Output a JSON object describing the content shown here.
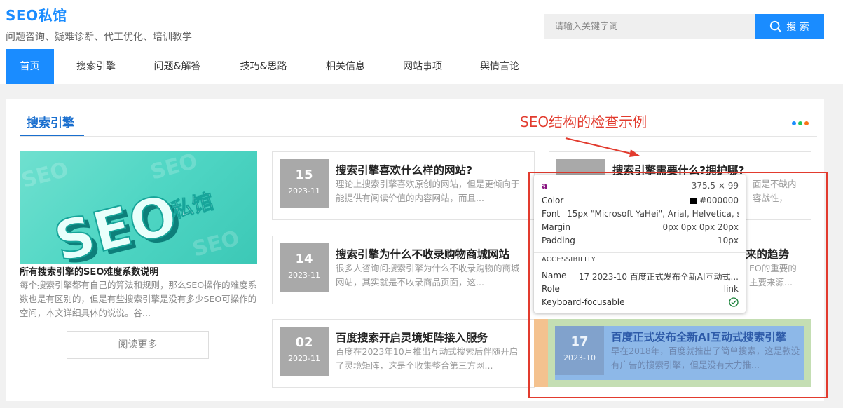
{
  "header": {
    "logo": "SEO私馆",
    "tagline": "问题咨询、疑难诊断、代工优化、培训教学",
    "search_placeholder": "请输入关键字词",
    "search_button": "搜 索"
  },
  "nav": {
    "items": [
      "首页",
      "搜索引擎",
      "问题&解答",
      "技巧&思路",
      "相关信息",
      "网站事项",
      "舆情言论"
    ],
    "active_index": 0
  },
  "section": {
    "title": "搜索引擎"
  },
  "featured": {
    "image_text": "SEO私馆",
    "title": "所有搜索引擎的SEO难度系数说明",
    "description": "每个搜索引擎都有自己的算法和规则，那么SEO操作的难度系数也是有区别的，但是有些搜索引擎是没有多少SEO可操作的空间，本文详细具体的说说。谷...",
    "read_more": "阅读更多"
  },
  "articles": [
    {
      "day": "15",
      "ym": "2023-11",
      "title": "搜索引擎喜欢什么样的网站?",
      "summary": "理论上搜索引擎喜欢原创的网站，但是更倾向于能提供有阅读价值的内容网站，而且..."
    },
    {
      "day": "14",
      "ym": "2023-11",
      "title": "搜索引擎为什么不收录购物商城网站",
      "summary": "很多人咨询问搜索引擎为什么不收录购物的商城网站，其实就是不收录商品页面，这..."
    },
    {
      "day": "02",
      "ym": "2023-11",
      "title": "百度搜索开启灵境矩阵接入服务",
      "summary": "百度在2023年10月推出互动式搜索后伴随开启了灵境矩阵，这是个收集整合第三方网..."
    },
    {
      "day": "",
      "ym": "",
      "title": "搜索引擎需要什么?拥护哪?",
      "summary": "面是不缺内容战性，那..."
    },
    {
      "day": "",
      "ym": "",
      "title": "来的趋势",
      "summary": "EO的重要的主要来源..."
    },
    {
      "day": "17",
      "ym": "2023-10",
      "title": "百度正式发布全新AI互动式搜索引擎",
      "summary": "早在2018年，百度就推出了简单搜索，这是款没有广告的搜索引擎，但是没有大力推..."
    }
  ],
  "annotation": {
    "label": "SEO结构的检查示例"
  },
  "inspector": {
    "tag": "a",
    "size": "375.5 × 99",
    "color_label": "Color",
    "color_value": "#000000",
    "font_label": "Font",
    "font_value": "15px \"Microsoft YaHei\", Arial, Helvetica, s...",
    "margin_label": "Margin",
    "margin_value": "0px 0px 0px 20px",
    "padding_label": "Padding",
    "padding_value": "10px",
    "accessibility_heading": "ACCESSIBILITY",
    "name_label": "Name",
    "name_value": "17 2023-10 百度正式发布全新AI互动式...",
    "role_label": "Role",
    "role_value": "link",
    "focusable_label": "Keyboard-focusable"
  },
  "colors": {
    "accent": "#1a8cff",
    "annotation_red": "#e23b2e",
    "dot_blue": "#1a8cff",
    "dot_green": "#22c55e",
    "dot_orange": "#f97316"
  }
}
